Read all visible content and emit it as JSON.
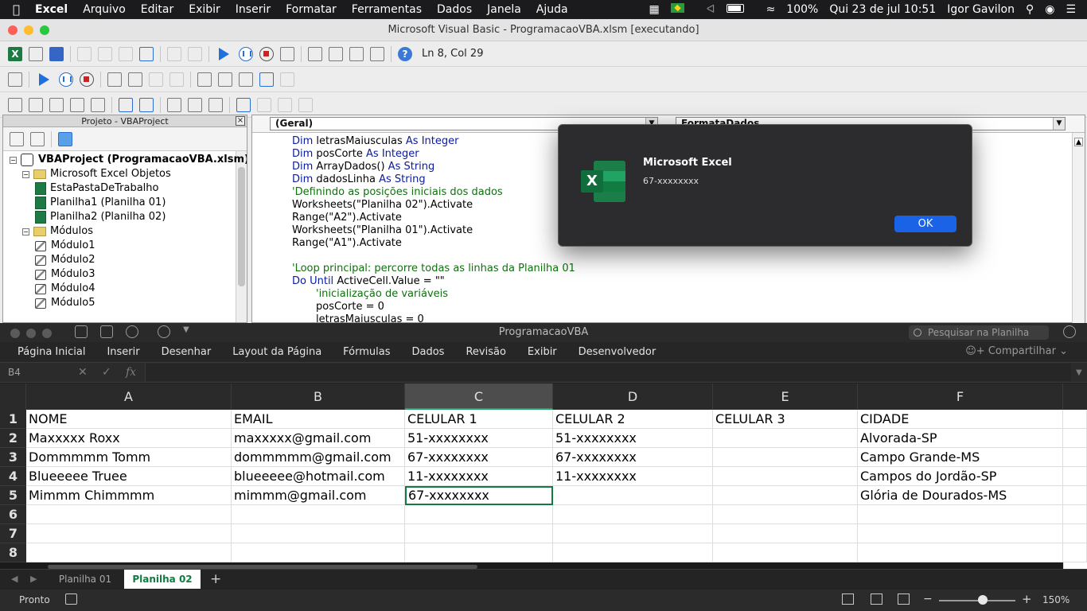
{
  "menubar": {
    "items": [
      "Excel",
      "Arquivo",
      "Editar",
      "Exibir",
      "Inserir",
      "Formatar",
      "Ferramentas",
      "Dados",
      "Janela",
      "Ajuda"
    ],
    "battery": "100%",
    "datetime": "Qui 23 de jul  10:51",
    "user": "Igor Gavilon"
  },
  "vbe": {
    "title": "Microsoft Visual Basic - ProgramacaoVBA.xlsm [executando]",
    "cursor_position": "Ln 8, Col 29",
    "project_panel": {
      "title": "Projeto - VBAProject",
      "close_label": "×",
      "tree": [
        {
          "label": "VBAProject (ProgramacaoVBA.xlsm)",
          "level": 0,
          "type": "project",
          "expander": "−"
        },
        {
          "label": "Microsoft Excel Objetos",
          "level": 1,
          "type": "folder",
          "expander": "−"
        },
        {
          "label": "EstaPastaDeTrabalho",
          "level": 2,
          "type": "sheet"
        },
        {
          "label": "Planilha1 (Planilha 01)",
          "level": 2,
          "type": "sheet"
        },
        {
          "label": "Planilha2 (Planilha 02)",
          "level": 2,
          "type": "sheet"
        },
        {
          "label": "Módulos",
          "level": 1,
          "type": "folder",
          "expander": "−"
        },
        {
          "label": "Módulo1",
          "level": 2,
          "type": "module"
        },
        {
          "label": "Módulo2",
          "level": 2,
          "type": "module"
        },
        {
          "label": "Módulo3",
          "level": 2,
          "type": "module"
        },
        {
          "label": "Módulo4",
          "level": 2,
          "type": "module"
        },
        {
          "label": "Módulo5",
          "level": 2,
          "type": "module"
        }
      ]
    },
    "code": {
      "object_combo": "(Geral)",
      "proc_combo": "FormataDados",
      "lines": [
        {
          "indent": 0,
          "parts": [
            {
              "t": "Dim ",
              "c": "kw"
            },
            {
              "t": "letrasMaiusculas ",
              "c": ""
            },
            {
              "t": "As Integer",
              "c": "kw"
            }
          ]
        },
        {
          "indent": 0,
          "parts": [
            {
              "t": "Dim ",
              "c": "kw"
            },
            {
              "t": "posCorte ",
              "c": ""
            },
            {
              "t": "As Integer",
              "c": "kw"
            }
          ]
        },
        {
          "indent": 0,
          "parts": [
            {
              "t": "Dim ",
              "c": "kw"
            },
            {
              "t": "ArrayDados() ",
              "c": ""
            },
            {
              "t": "As String",
              "c": "kw"
            }
          ]
        },
        {
          "indent": 0,
          "parts": [
            {
              "t": "Dim ",
              "c": "kw"
            },
            {
              "t": "dadosLinha ",
              "c": ""
            },
            {
              "t": "As String",
              "c": "kw"
            }
          ]
        },
        {
          "indent": 0,
          "parts": [
            {
              "t": "'Definindo as posições iniciais dos dados",
              "c": "cm"
            }
          ]
        },
        {
          "indent": 0,
          "parts": [
            {
              "t": "Worksheets(\"Planilha 02\").Activate",
              "c": ""
            }
          ]
        },
        {
          "indent": 0,
          "parts": [
            {
              "t": "Range(\"A2\").Activate",
              "c": ""
            }
          ]
        },
        {
          "indent": 0,
          "parts": [
            {
              "t": "Worksheets(\"Planilha 01\").Activate",
              "c": ""
            }
          ]
        },
        {
          "indent": 0,
          "parts": [
            {
              "t": "Range(\"A1\").Activate",
              "c": ""
            }
          ]
        },
        {
          "indent": 0,
          "parts": []
        },
        {
          "indent": 0,
          "parts": [
            {
              "t": "'Loop principal: percorre todas as linhas da Planilha 01",
              "c": "cm"
            }
          ]
        },
        {
          "indent": 0,
          "parts": [
            {
              "t": "Do Until ",
              "c": "kw"
            },
            {
              "t": "ActiveCell.Value = \"\"",
              "c": ""
            }
          ]
        },
        {
          "indent": 1,
          "parts": [
            {
              "t": "'inicialização de variáveis",
              "c": "cm"
            }
          ]
        },
        {
          "indent": 1,
          "parts": [
            {
              "t": "posCorte = 0",
              "c": ""
            }
          ]
        },
        {
          "indent": 1,
          "parts": [
            {
              "t": "letrasMaiusculas = 0",
              "c": ""
            }
          ]
        }
      ]
    }
  },
  "dialog": {
    "app_glyph": "X",
    "title": "Microsoft Excel",
    "message": "67-xxxxxxxx",
    "ok_label": "OK"
  },
  "excel": {
    "workbook_name": "ProgramacaoVBA",
    "search_placeholder": "Pesquisar na Planilha",
    "ribbon_tabs": [
      "Página Inicial",
      "Inserir",
      "Desenhar",
      "Layout da Página",
      "Fórmulas",
      "Dados",
      "Revisão",
      "Exibir",
      "Desenvolvedor"
    ],
    "share_label": "Compartilhar",
    "name_box": "B4",
    "fx_label": "fx",
    "columns": [
      "A",
      "B",
      "C",
      "D",
      "E",
      "F"
    ],
    "selected_column": "C",
    "rows": [
      [
        "NOME",
        "EMAIL",
        "CELULAR 1",
        "CELULAR 2",
        "CELULAR 3",
        "CIDADE"
      ],
      [
        "Maxxxxx Roxx",
        "maxxxxx@gmail.com",
        "51-xxxxxxxx",
        "51-xxxxxxxx",
        "",
        "Alvorada-SP"
      ],
      [
        "Dommmmm Tomm",
        "dommmmm@gmail.com",
        "67-xxxxxxxx",
        "67-xxxxxxxx",
        "",
        "Campo Grande-MS"
      ],
      [
        "Blueeeee Truee",
        "blueeeee@hotmail.com",
        "11-xxxxxxxx",
        "11-xxxxxxxx",
        "",
        "Campos do Jordão-SP"
      ],
      [
        "Mimmm Chimmmm",
        "mimmm@gmail.com",
        "67-xxxxxxxx",
        "",
        "",
        "Glória de Dourados-MS"
      ],
      [
        "",
        "",
        "",
        "",
        "",
        ""
      ],
      [
        "",
        "",
        "",
        "",
        "",
        ""
      ],
      [
        "",
        "",
        "",
        "",
        "",
        ""
      ]
    ],
    "row_numbers": [
      "1",
      "2",
      "3",
      "4",
      "5",
      "6",
      "7",
      "8"
    ],
    "active_cell": {
      "row": 4,
      "col": 2
    },
    "sheet_tabs": [
      {
        "label": "Planilha 01",
        "active": false
      },
      {
        "label": "Planilha 02",
        "active": true
      }
    ],
    "status": "Pronto",
    "zoom": "150%",
    "accent": "#107c41"
  }
}
